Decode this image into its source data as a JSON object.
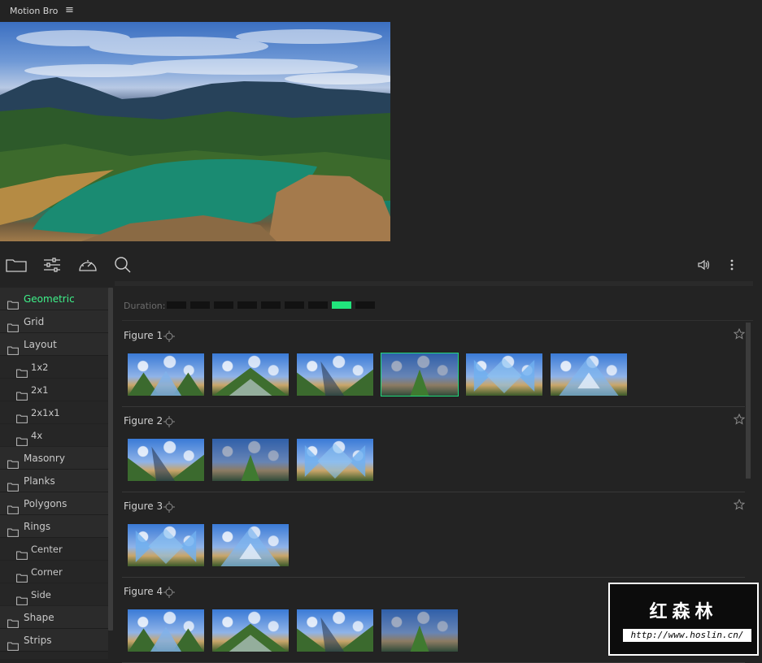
{
  "app": {
    "title": "Motion Bro",
    "menu_glyph": "≡"
  },
  "toolbar": {
    "left_icons": [
      "folder-icon",
      "sliders-icon",
      "speedometer-icon",
      "search-icon"
    ],
    "right_icons": [
      "speaker-icon",
      "more-vertical-icon"
    ]
  },
  "sidebar": {
    "items": [
      {
        "label": "Geometric",
        "level": 0,
        "active": true
      },
      {
        "label": "Grid",
        "level": 0
      },
      {
        "label": "Layout",
        "level": 0
      },
      {
        "label": "1x2",
        "level": 1
      },
      {
        "label": "2x1",
        "level": 1
      },
      {
        "label": "2x1x1",
        "level": 1
      },
      {
        "label": "4x",
        "level": 1
      },
      {
        "label": "Masonry",
        "level": 0
      },
      {
        "label": "Planks",
        "level": 0
      },
      {
        "label": "Polygons",
        "level": 0
      },
      {
        "label": "Rings",
        "level": 0
      },
      {
        "label": "Center",
        "level": 1
      },
      {
        "label": "Corner",
        "level": 1
      },
      {
        "label": "Side",
        "level": 1
      },
      {
        "label": "Shape",
        "level": 0
      },
      {
        "label": "Strips",
        "level": 0
      }
    ]
  },
  "duration": {
    "label": "Duration:",
    "segments": 9,
    "selected_index": 7
  },
  "sections": [
    {
      "title": "Figure 1",
      "thumbs": 6,
      "selected_index": 3
    },
    {
      "title": "Figure 2",
      "thumbs": 3,
      "selected_index": -1
    },
    {
      "title": "Figure 3",
      "thumbs": 2,
      "selected_index": -1
    },
    {
      "title": "Figure 4",
      "thumbs": 4,
      "selected_index": -1
    }
  ],
  "watermark": {
    "cn": "红森林",
    "url": "http://www.hoslin.cn/"
  },
  "colors": {
    "accent": "#21e47c",
    "background": "#232323",
    "panel": "#2b2b2b"
  }
}
